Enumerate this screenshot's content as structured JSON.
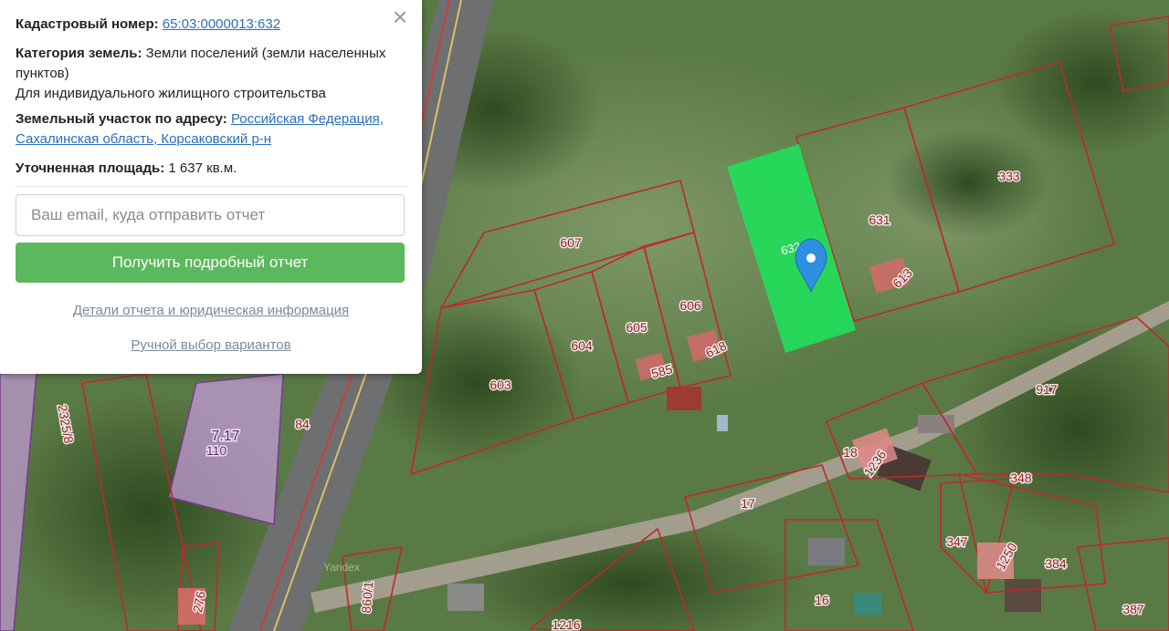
{
  "card": {
    "cadastral_label": "Кадастровый номер:",
    "cadastral_value": "65:03:0000013:632",
    "category_label": "Категория земель:",
    "category_value": "Земли поселений (земли населенных пунктов)",
    "use_value": "Для индивидуального жилищного строительства",
    "address_label": "Земельный участок по адресу:",
    "address_value": "Российская Федерация, Сахалинская область, Корсаковский р-н",
    "area_label": "Уточненная площадь:",
    "area_value": "1 637 кв.м.",
    "email_placeholder": "Ваш email, куда отправить отчет",
    "submit_label": "Получить подробный отчет",
    "details_link": "Детали отчета и юридическая информация",
    "manual_link": "Ручной выбор вариантов",
    "close_symbol": "×",
    "close_icon": "close-icon",
    "button_color": "#5cb85c"
  },
  "map": {
    "selected_parcel_color": "#22dd5a",
    "parcel_border_color": "#c0282c",
    "marker_color": "#2f8fe0",
    "marker_icon": "map-pin-icon",
    "selected_parcel_label": "632",
    "parcel_labels": [
      "607",
      "631",
      "333",
      "613",
      "606",
      "605",
      "604",
      "618",
      "585",
      "603",
      "917",
      "18",
      "1236",
      "348",
      "347",
      "1250",
      "384",
      "17",
      "16",
      "387",
      "2325/8",
      "84",
      "110",
      "276",
      "860/1",
      "1216"
    ],
    "zone_label": "7.17",
    "watermark": "Yandex"
  }
}
